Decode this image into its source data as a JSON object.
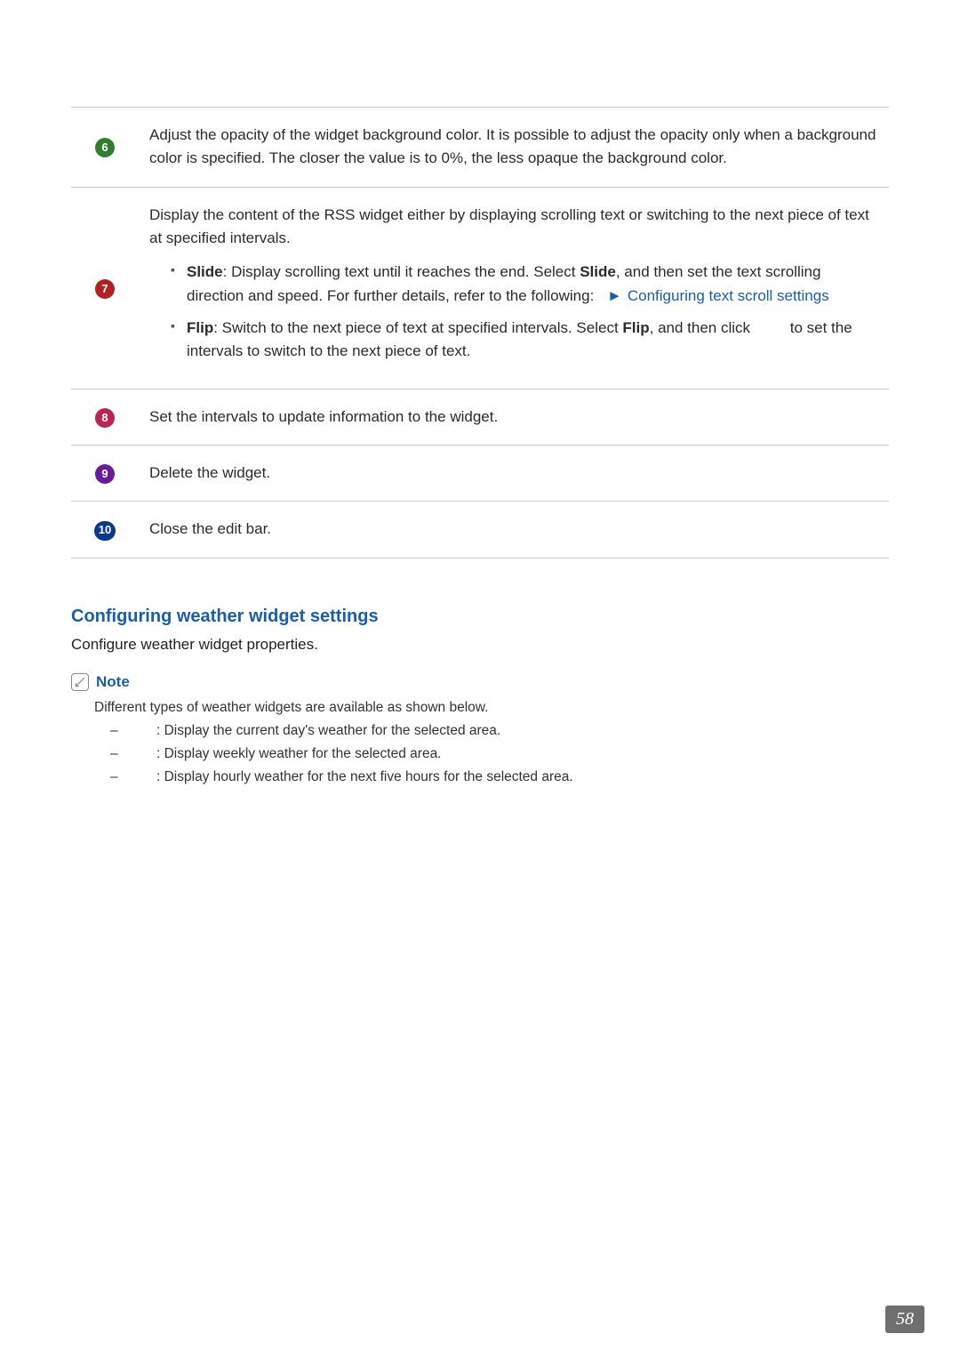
{
  "table": {
    "rows": [
      {
        "badge": {
          "num": "6",
          "colorClass": "green"
        },
        "html": "Adjust the opacity of the widget background color. It is possible to adjust the opacity only when a background color is specified. The closer the value is to 0%, the less opaque the background color."
      },
      {
        "badge": {
          "num": "7",
          "colorClass": "red"
        },
        "intro": "Display the content of the RSS widget either by displaying scrolling text or switching to the next piece of text at specified intervals.",
        "bullets": [
          {
            "lead": "Slide",
            "rest_a": ": Display scrolling text until it reaches the end. Select ",
            "lead2": "Slide",
            "rest_b": ", and then set the text scrolling direction and speed. For further details, refer to the following:",
            "link": "Configuring text scroll settings",
            "hasLink": true
          },
          {
            "lead": "Flip",
            "rest_a": ": Switch to the next piece of text at specified intervals. Select ",
            "lead2": "Flip",
            "rest_b": ", and then click",
            "tail": " to set the intervals to switch to the next piece of text.",
            "hasLink": false
          }
        ]
      },
      {
        "badge": {
          "num": "8",
          "colorClass": "pink"
        },
        "html": "Set the intervals to update information to the widget."
      },
      {
        "badge": {
          "num": "9",
          "colorClass": "purple"
        },
        "html": "Delete the widget."
      },
      {
        "badge": {
          "num": "10",
          "colorClass": "blue"
        },
        "html": "Close the edit bar."
      }
    ]
  },
  "section": {
    "heading": "Configuring weather widget settings",
    "paragraph": "Configure weather widget properties."
  },
  "note": {
    "label": "Note",
    "intro": "Different types of weather widgets are available as shown below.",
    "items": [
      ": Display the current day's weather for the selected area.",
      ": Display weekly weather for the selected area.",
      ": Display hourly weather for the next five hours for the selected area."
    ]
  },
  "pageNumber": "58"
}
